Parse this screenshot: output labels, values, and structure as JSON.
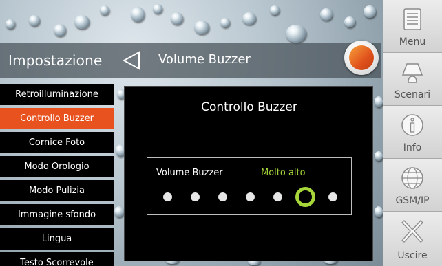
{
  "header": {
    "title": "Impostazione",
    "subtitle": "Volume Buzzer"
  },
  "menu": {
    "items": [
      {
        "label": "Retroilluminazione",
        "active": false
      },
      {
        "label": "Controllo Buzzer",
        "active": true
      },
      {
        "label": "Cornice Foto",
        "active": false
      },
      {
        "label": "Modo Orologio",
        "active": false
      },
      {
        "label": "Modo Pulizia",
        "active": false
      },
      {
        "label": "Immagine sfondo",
        "active": false
      },
      {
        "label": "Lingua",
        "active": false
      },
      {
        "label": "Testo Scorrevole",
        "active": false
      }
    ]
  },
  "sidebar": {
    "items": [
      {
        "label": "Menu",
        "icon": "menu-list-icon"
      },
      {
        "label": "Scenari",
        "icon": "scenes-icon"
      },
      {
        "label": "Info",
        "icon": "info-icon"
      },
      {
        "label": "GSM/IP",
        "icon": "globe-icon"
      },
      {
        "label": "Uscire",
        "icon": "exit-x-icon"
      }
    ]
  },
  "dialog": {
    "title": "Controllo Buzzer",
    "volume_label": "Volume Buzzer",
    "volume_value": "Molto alto",
    "levels": 7,
    "selected_level": 6
  },
  "colors": {
    "accent": "#e8521f",
    "selected": "#a6d63a"
  }
}
